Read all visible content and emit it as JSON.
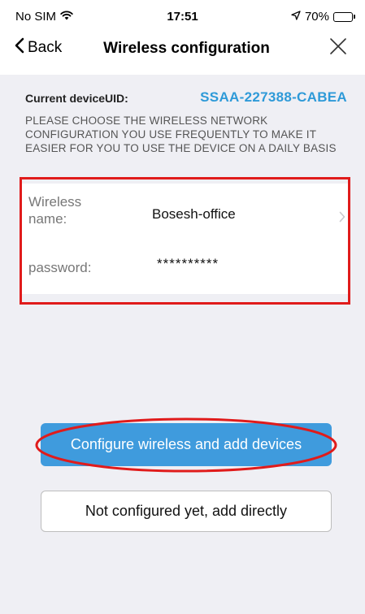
{
  "status_bar": {
    "carrier": "No SIM",
    "time": "17:51",
    "battery": "70%",
    "battery_level": 0.7
  },
  "nav": {
    "back_label": "Back",
    "title": "Wireless configuration"
  },
  "device": {
    "uid_label": "Current deviceUID:",
    "uid_value": "SSAA-227388-CABEA"
  },
  "instructions": "PLEASE CHOOSE THE WIRELESS NETWORK CONFIGURATION YOU USE FREQUENTLY TO MAKE IT EASIER FOR YOU TO USE THE DEVICE ON A DAILY BASIS",
  "form": {
    "wifi_label": "Wireless name:",
    "wifi_value": "Bosesh-office",
    "password_label": "password:",
    "password_value": "**********"
  },
  "buttons": {
    "configure": "Configure wireless and add devices",
    "skip": "Not configured yet, add directly"
  },
  "colors": {
    "accent": "#3f9bdd",
    "uid_text": "#2e9ad8",
    "annotation": "#e01b1b",
    "background": "#efeff4"
  },
  "icons": {
    "wifi": "wifi-icon",
    "location": "location-arrow-icon",
    "battery": "battery-icon",
    "back": "chevron-left-icon",
    "close": "close-icon",
    "row_chevron": "chevron-right-icon"
  }
}
